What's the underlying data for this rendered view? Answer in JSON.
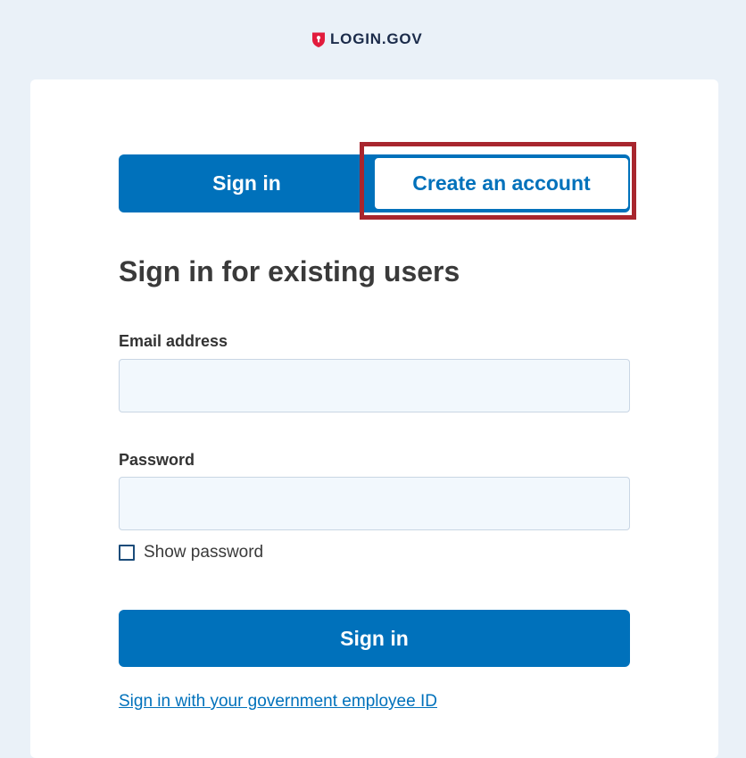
{
  "header": {
    "logo_text": "LOGIN.GOV",
    "logo_icon": "shield-lock-icon"
  },
  "tabs": {
    "sign_in": "Sign in",
    "create_account": "Create an account",
    "active": "sign_in"
  },
  "form": {
    "title": "Sign in for existing users",
    "email_label": "Email address",
    "email_value": "",
    "password_label": "Password",
    "password_value": "",
    "show_password_label": "Show password",
    "show_password_checked": false,
    "submit_label": "Sign in"
  },
  "links": {
    "piv_cac": "Sign in with your government employee ID"
  },
  "colors": {
    "primary": "#0071bb",
    "page_background": "#eaf1f8",
    "input_background": "#f2f8fd",
    "highlight": "#a8262e",
    "logo_text": "#1b2b4a"
  }
}
